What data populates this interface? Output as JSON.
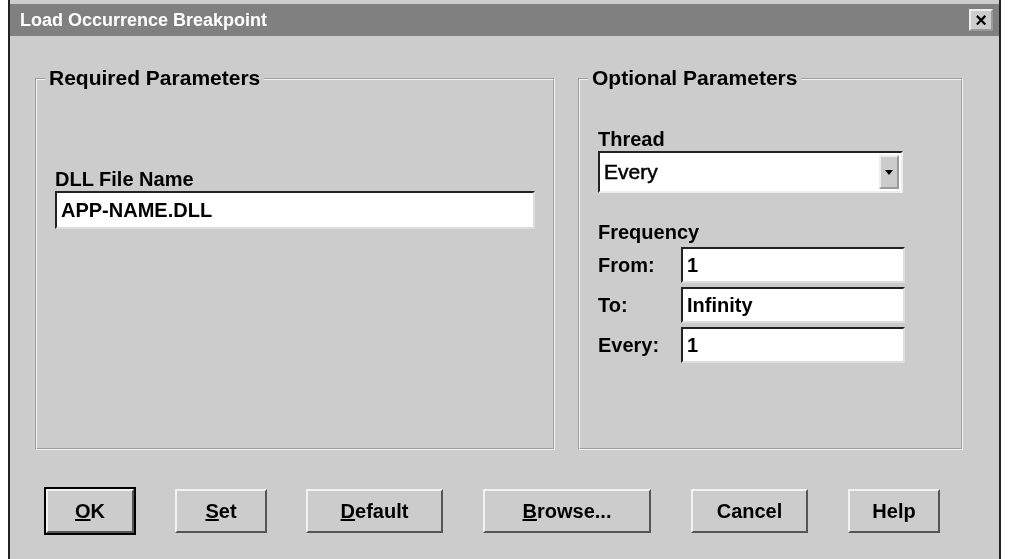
{
  "window": {
    "title": "Load Occurrence Breakpoint",
    "close": "×"
  },
  "required": {
    "title": "Required Parameters",
    "dll_label": "DLL File Name",
    "dll_value": "APP-NAME.DLL"
  },
  "optional": {
    "title": "Optional Parameters",
    "thread_label": "Thread",
    "thread_value": "Every",
    "frequency_label": "Frequency",
    "fields": [
      {
        "label": "From:",
        "value": "1"
      },
      {
        "label": "To:",
        "value": "Infinity"
      },
      {
        "label": "Every:",
        "value": "1"
      }
    ]
  },
  "buttons": [
    {
      "mnemonic": "O",
      "rest": "K",
      "default": true
    },
    {
      "mnemonic": "S",
      "rest": "et",
      "default": false
    },
    {
      "mnemonic": "D",
      "rest": "efault",
      "default": false
    },
    {
      "mnemonic": "B",
      "rest": "rowse...",
      "default": false
    },
    {
      "rest": "Cancel",
      "default": false
    },
    {
      "rest": "Help",
      "default": false
    }
  ]
}
